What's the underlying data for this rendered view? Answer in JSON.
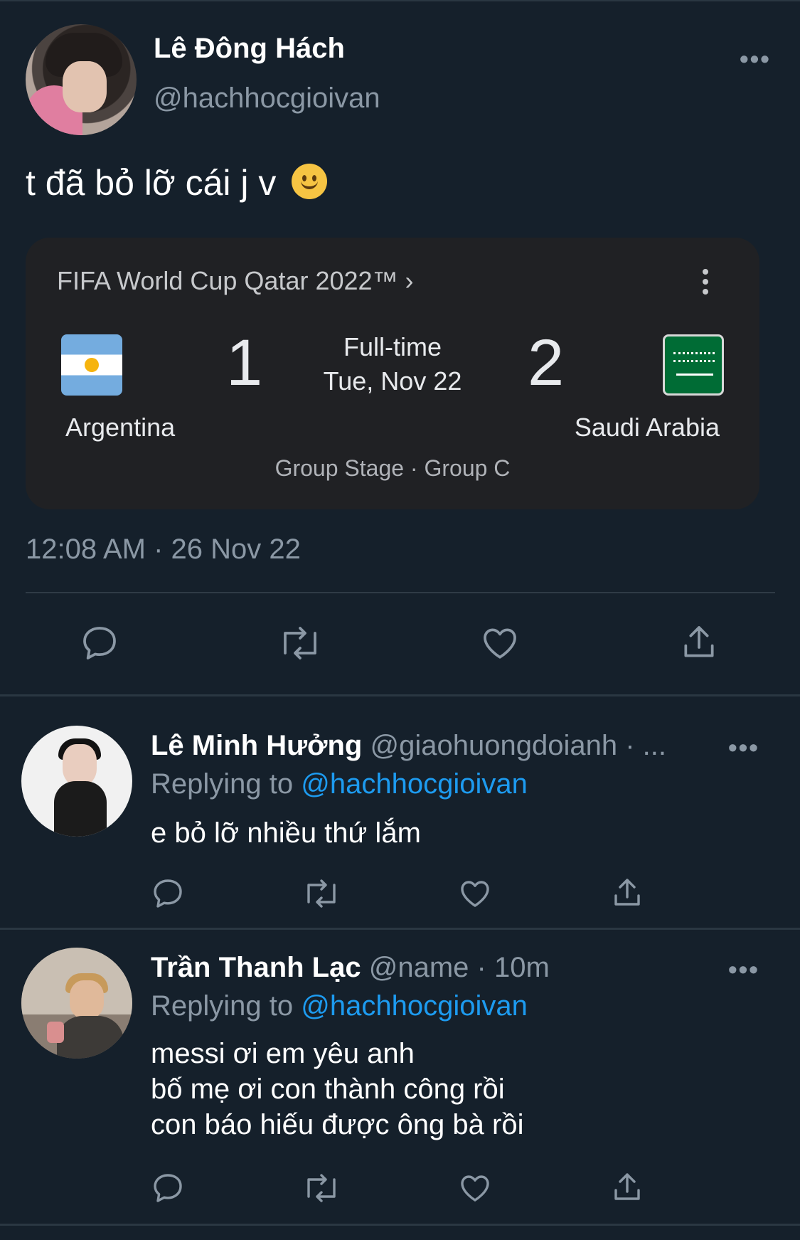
{
  "main_tweet": {
    "display_name": "Lê Đông Hách",
    "handle": "@hachhocgioivan",
    "text": "t đã bỏ lỡ cái j v",
    "emoji": "slightly-smiling-face",
    "timestamp": "12:08 AM · 26 Nov 22",
    "more_icon": "more-horizontal-icon"
  },
  "match_card": {
    "title": "FIFA World Cup Qatar 2022™ ›",
    "home_team": "Argentina",
    "home_score": "1",
    "away_team": "Saudi Arabia",
    "away_score": "2",
    "status": "Full-time",
    "date": "Tue, Nov 22",
    "stage": "Group Stage · Group C",
    "home_flag": "argentina-flag",
    "away_flag": "saudi-arabia-flag"
  },
  "actions": {
    "icons": [
      "reply-icon",
      "retweet-icon",
      "like-icon",
      "share-icon"
    ]
  },
  "replies": [
    {
      "display_name": "Lê Minh Hưởng",
      "meta": "@giaohuongdoianh · ...",
      "replying_prefix": "Replying to ",
      "replying_to": "@hachhocgioivan",
      "text_lines": [
        "e bỏ lỡ nhiều thứ lắm"
      ]
    },
    {
      "display_name": "Trần Thanh Lạc",
      "meta": "@name · 10m",
      "replying_prefix": "Replying to ",
      "replying_to": "@hachhocgioivan",
      "text_lines": [
        "messi ơi em yêu anh",
        "bố mẹ ơi con thành công rồi",
        "con báo hiếu được ông bà rồi"
      ]
    }
  ],
  "colors": {
    "background": "#15202b",
    "card_background": "#202124",
    "accent": "#1d9bf0",
    "secondary_text": "#8b98a5"
  }
}
